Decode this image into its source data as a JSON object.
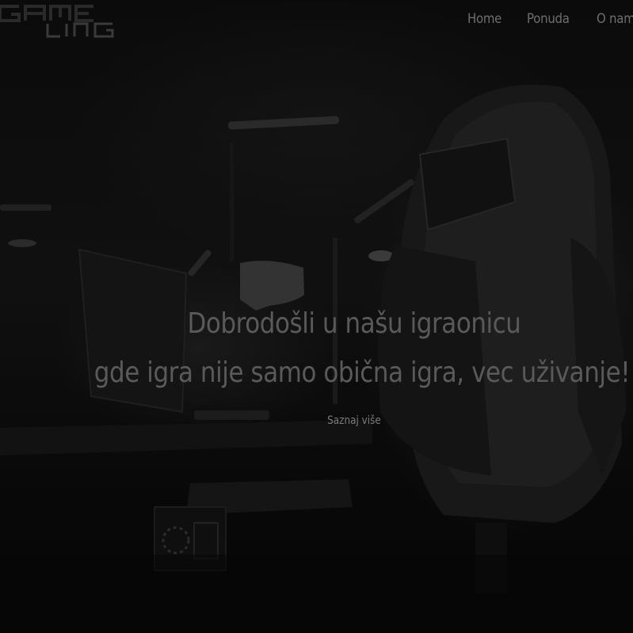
{
  "header": {
    "logo_alt": "GAMING",
    "nav": [
      {
        "label": "Home"
      },
      {
        "label": "Ponuda"
      },
      {
        "label": "O nama"
      }
    ]
  },
  "hero": {
    "line1": "Dobrodošli u našu igraonicu",
    "line2": "gde igra nije samo obična igra, vec uživanje!",
    "cta_label": "Saznaj više"
  },
  "colors": {
    "background": "#0a0a0a",
    "text": "#5a5a5a",
    "nav_text": "#6e6e6e"
  }
}
